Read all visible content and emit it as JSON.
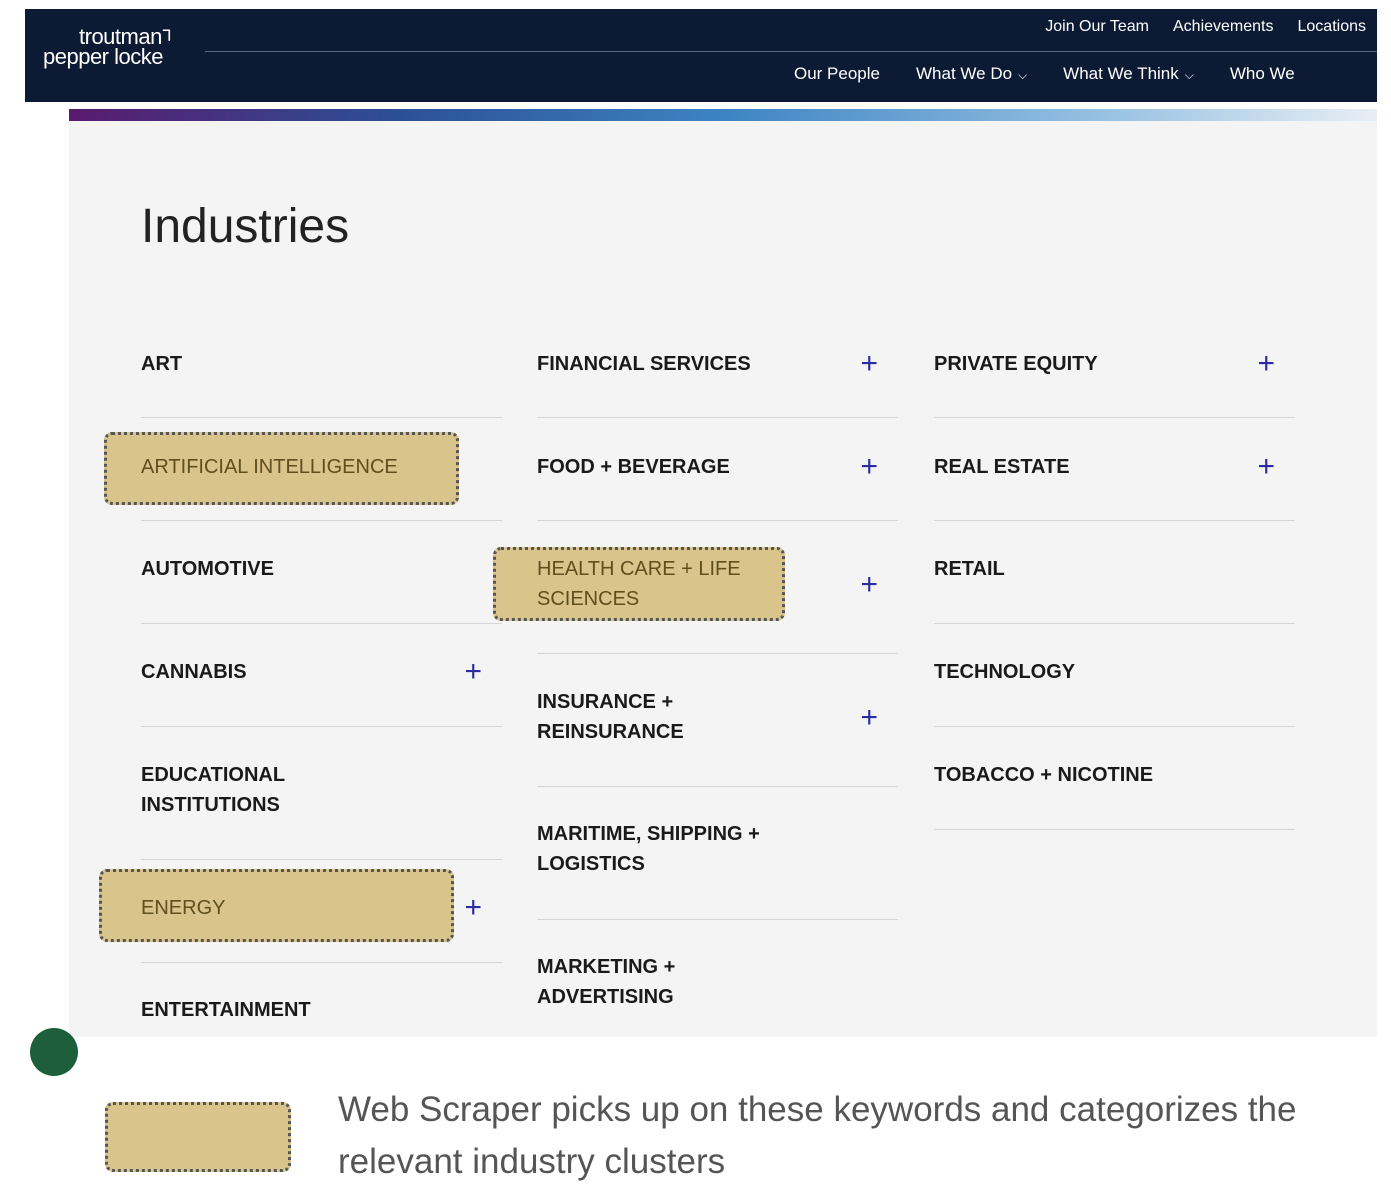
{
  "header": {
    "logo_line1": "troutman",
    "logo_line2": "pepper locke",
    "logo_mark": "ᒣ",
    "utility_links": [
      "Join Our Team",
      "Achievements",
      "Locations"
    ],
    "main_nav": {
      "our_people": "Our People",
      "what_we_do": "What We Do",
      "what_we_think": "What We Think",
      "who_we": "Who We"
    },
    "chevron": "⌵"
  },
  "page": {
    "title": "Industries",
    "plus_icon": "+",
    "columns": [
      [
        {
          "label": "ART",
          "has_plus": false,
          "highlighted": false
        },
        {
          "label": "ARTIFICIAL INTELLIGENCE",
          "has_plus": false,
          "highlighted": true
        },
        {
          "label": "AUTOMOTIVE",
          "has_plus": false,
          "highlighted": false
        },
        {
          "label": "CANNABIS",
          "has_plus": true,
          "highlighted": false
        },
        {
          "label": "EDUCATIONAL INSTITUTIONS",
          "has_plus": false,
          "highlighted": false
        },
        {
          "label": "ENERGY",
          "has_plus": true,
          "highlighted": true
        },
        {
          "label": "ENTERTAINMENT",
          "has_plus": false,
          "highlighted": false
        }
      ],
      [
        {
          "label": "FINANCIAL SERVICES",
          "has_plus": true,
          "highlighted": false
        },
        {
          "label": "FOOD + BEVERAGE",
          "has_plus": true,
          "highlighted": false
        },
        {
          "label": "HEALTH CARE + LIFE SCIENCES",
          "has_plus": true,
          "highlighted": true
        },
        {
          "label": "INSURANCE + REINSURANCE",
          "has_plus": true,
          "highlighted": false
        },
        {
          "label": "MARITIME, SHIPPING + LOGISTICS",
          "has_plus": false,
          "highlighted": false
        },
        {
          "label": "MARKETING + ADVERTISING",
          "has_plus": false,
          "highlighted": false
        }
      ],
      [
        {
          "label": "PRIVATE EQUITY",
          "has_plus": true,
          "highlighted": false
        },
        {
          "label": "REAL ESTATE",
          "has_plus": true,
          "highlighted": false
        },
        {
          "label": "RETAIL",
          "has_plus": false,
          "highlighted": false
        },
        {
          "label": "TECHNOLOGY",
          "has_plus": false,
          "highlighted": false
        },
        {
          "label": "TOBACCO + NICOTINE",
          "has_plus": false,
          "highlighted": false
        }
      ]
    ]
  },
  "legend": {
    "text": "Web Scraper picks up on these keywords and categorizes the relevant industry clusters"
  },
  "colors": {
    "navbar": "#0c1b33",
    "highlight": "#d9c48c",
    "plus": "#2c2ca0",
    "panel": "#f4f4f4"
  }
}
